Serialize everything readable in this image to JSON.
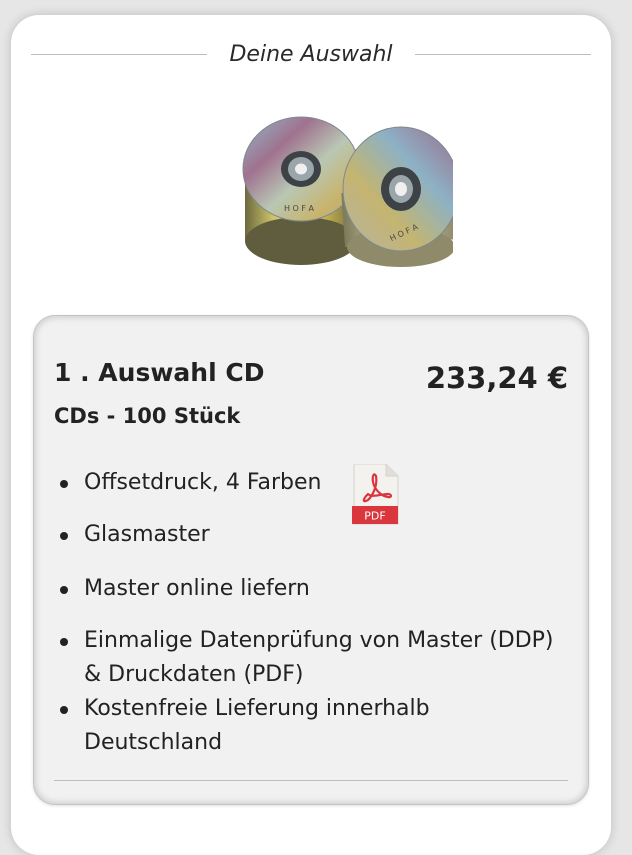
{
  "selection": {
    "header_title": "Deine Auswahl",
    "product_image_alt": "CD-Spindel mit bedruckten CDs",
    "summary": {
      "title": "1 . Auswahl  CD",
      "price": "233,24 €",
      "subtitle": "CDs - 100 Stück",
      "pdf_label": "PDF",
      "features": [
        "Offsetdruck, 4 Farben",
        "Glasmaster",
        "Master online liefern",
        "Einmalige Datenprüfung von Master (DDP) & Druckdaten (PDF)",
        "Kostenfreie Lieferung innerhalb Deutschland"
      ]
    }
  },
  "colors": {
    "card_background": "#ffffff",
    "summary_background": "#f1f1f1",
    "text": "#222222",
    "pdf_red": "#d9363e"
  }
}
